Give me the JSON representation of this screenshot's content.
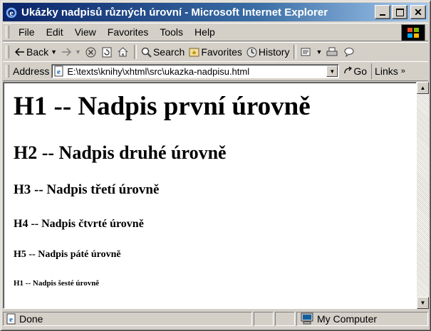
{
  "window": {
    "title": "Ukázky nadpisů různých úrovní - Microsoft Internet Explorer"
  },
  "menubar": {
    "items": [
      "File",
      "Edit",
      "View",
      "Favorites",
      "Tools",
      "Help"
    ]
  },
  "toolbar": {
    "back": "Back",
    "search": "Search",
    "favorites": "Favorites",
    "history": "History"
  },
  "address": {
    "label": "Address",
    "url": "E:\\texts\\knihy\\xhtml\\src\\ukazka-nadpisu.html",
    "go": "Go",
    "links": "Links"
  },
  "content": {
    "h1": "H1 -- Nadpis první úrovně",
    "h2": "H2 -- Nadpis druhé úrovně",
    "h3": "H3 -- Nadpis třetí úrovně",
    "h4": "H4 -- Nadpis čtvrté úrovně",
    "h5": "H5 -- Nadpis páté úrovně",
    "h6": "H1 -- Nadpis šesté úrovně"
  },
  "status": {
    "text": "Done",
    "zone": "My Computer"
  },
  "colors": {
    "titlebar_start": "#0a246a",
    "titlebar_end": "#a6caf0",
    "chrome": "#d4d0c8"
  }
}
